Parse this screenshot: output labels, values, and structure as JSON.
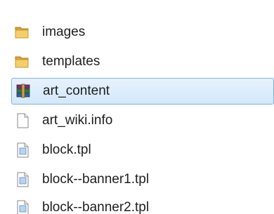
{
  "items": [
    {
      "name": "images",
      "icon": "folder-icon",
      "selected": false
    },
    {
      "name": "templates",
      "icon": "folder-icon",
      "selected": false
    },
    {
      "name": "art_content",
      "icon": "winrar-archive-icon",
      "selected": true
    },
    {
      "name": "art_wiki.info",
      "icon": "blank-document-icon",
      "selected": false
    },
    {
      "name": "block.tpl",
      "icon": "tpl-document-icon",
      "selected": false
    },
    {
      "name": "block--banner1.tpl",
      "icon": "tpl-document-icon",
      "selected": false
    },
    {
      "name": "block--banner2.tpl",
      "icon": "tpl-document-icon",
      "selected": false
    }
  ],
  "colors": {
    "selection_border": "#7eb4ea",
    "selection_fill": "#dcebfc",
    "folder": "#e8b94a",
    "text": "#1e1e1e"
  }
}
